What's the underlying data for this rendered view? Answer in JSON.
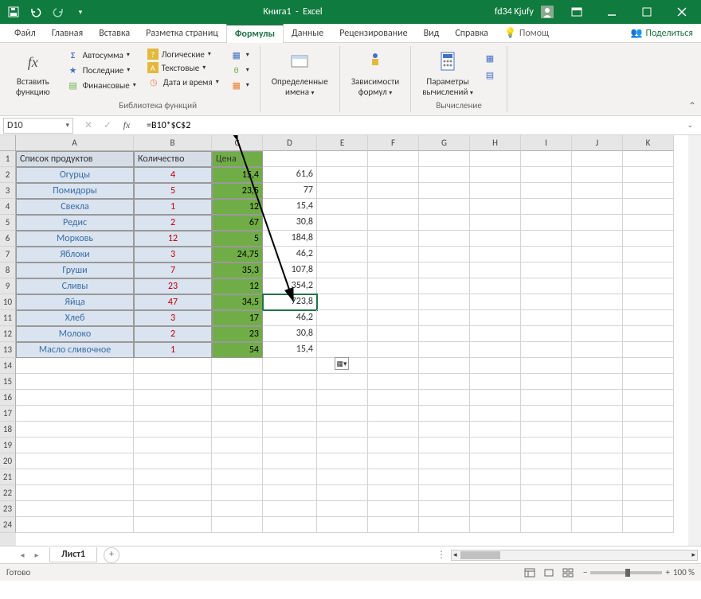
{
  "title": {
    "book": "Книга1",
    "app": "Excel",
    "user": "fd34 Kjufy"
  },
  "tabs": {
    "file": "Файл",
    "home": "Главная",
    "insert": "Вставка",
    "layout": "Разметка страниц",
    "formulas": "Формулы",
    "data": "Данные",
    "review": "Рецензирование",
    "view": "Вид",
    "help": "Справка",
    "tellme": "Помощ",
    "share": "Поделиться"
  },
  "ribbon": {
    "insertfn_line1": "Вставить",
    "insertfn_line2": "функцию",
    "autosum": "Автосумма",
    "recent": "Последние",
    "financial": "Финансовые",
    "logical": "Логические",
    "text": "Текстовые",
    "datetime": "Дата и время",
    "lib_label": "Библиотека функций",
    "defnames_line1": "Определенные",
    "defnames_line2": "имена",
    "deps_line1": "Зависимости",
    "deps_line2": "формул",
    "calcopt_line1": "Параметры",
    "calcopt_line2": "вычислений",
    "calc_label": "Вычисление"
  },
  "namebox": "D10",
  "formula": "=B10*$C$2",
  "cols": [
    "A",
    "B",
    "C",
    "D",
    "E",
    "F",
    "G",
    "H",
    "I",
    "J",
    "K"
  ],
  "headers": {
    "a": "Список продуктов",
    "b": "Количество",
    "c": "Цена"
  },
  "rows": [
    {
      "p": "Огурцы",
      "q": "4",
      "c": "15,4",
      "d": "61,6"
    },
    {
      "p": "Помидоры",
      "q": "5",
      "c": "23,5",
      "d": "77"
    },
    {
      "p": "Свекла",
      "q": "1",
      "c": "12",
      "d": "15,4"
    },
    {
      "p": "Редис",
      "q": "2",
      "c": "67",
      "d": "30,8"
    },
    {
      "p": "Морковь",
      "q": "12",
      "c": "5",
      "d": "184,8"
    },
    {
      "p": "Яблоки",
      "q": "3",
      "c": "24,75",
      "d": "46,2"
    },
    {
      "p": "Груши",
      "q": "7",
      "c": "35,3",
      "d": "107,8"
    },
    {
      "p": "Сливы",
      "q": "23",
      "c": "12",
      "d": "354,2"
    },
    {
      "p": "Яйца",
      "q": "47",
      "c": "34,5",
      "d": "723,8"
    },
    {
      "p": "Хлеб",
      "q": "3",
      "c": "17",
      "d": "46,2"
    },
    {
      "p": "Молоко",
      "q": "2",
      "c": "23",
      "d": "30,8"
    },
    {
      "p": "Масло сливочное",
      "q": "1",
      "c": "54",
      "d": "15,4"
    }
  ],
  "sheet": "Лист1",
  "status": "Готово",
  "zoom": "100 %"
}
